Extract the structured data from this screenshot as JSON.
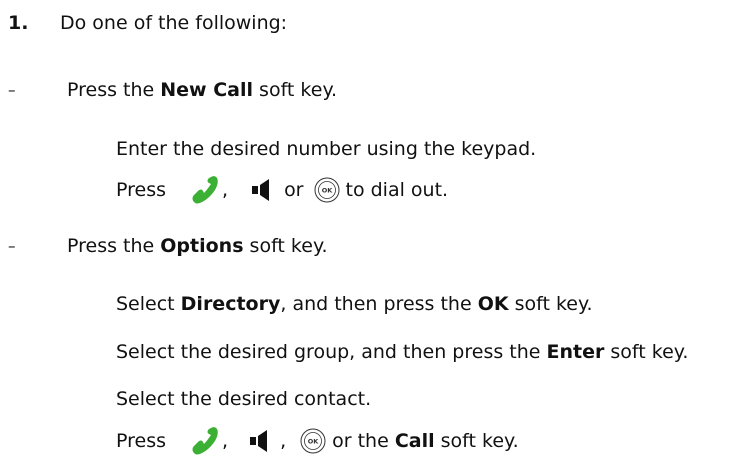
{
  "step": {
    "number": "1.",
    "intro": "Do one of the following:"
  },
  "option1": {
    "dash": "–",
    "pre": "Press the ",
    "key": "New Call",
    "post": " soft key.",
    "sub1": "Enter the desired number using the keypad.",
    "sub2": {
      "press": "Press",
      "comma": ",",
      "or": "or",
      "post": "to dial out."
    }
  },
  "option2": {
    "dash": "–",
    "pre": "Press the ",
    "key": "Options",
    "post": " soft key.",
    "sub1": {
      "pre": "Select ",
      "item": "Directory",
      "mid": ", and then press the ",
      "key": "OK",
      "post": " soft key."
    },
    "sub2": {
      "pre": "Select the desired group, and then press the ",
      "key": "Enter",
      "post": " soft key."
    },
    "sub3": "Select the desired contact.",
    "sub4": {
      "press": "Press",
      "comma1": ",",
      "comma2": ",",
      "or": "or the ",
      "key": "Call",
      "post": " soft key."
    }
  },
  "icons": {
    "handset": "handset-icon",
    "speaker": "speakerphone-icon",
    "ok": "ok-key-icon",
    "ok_label": "OK",
    "handset_color": "#3cb034"
  }
}
